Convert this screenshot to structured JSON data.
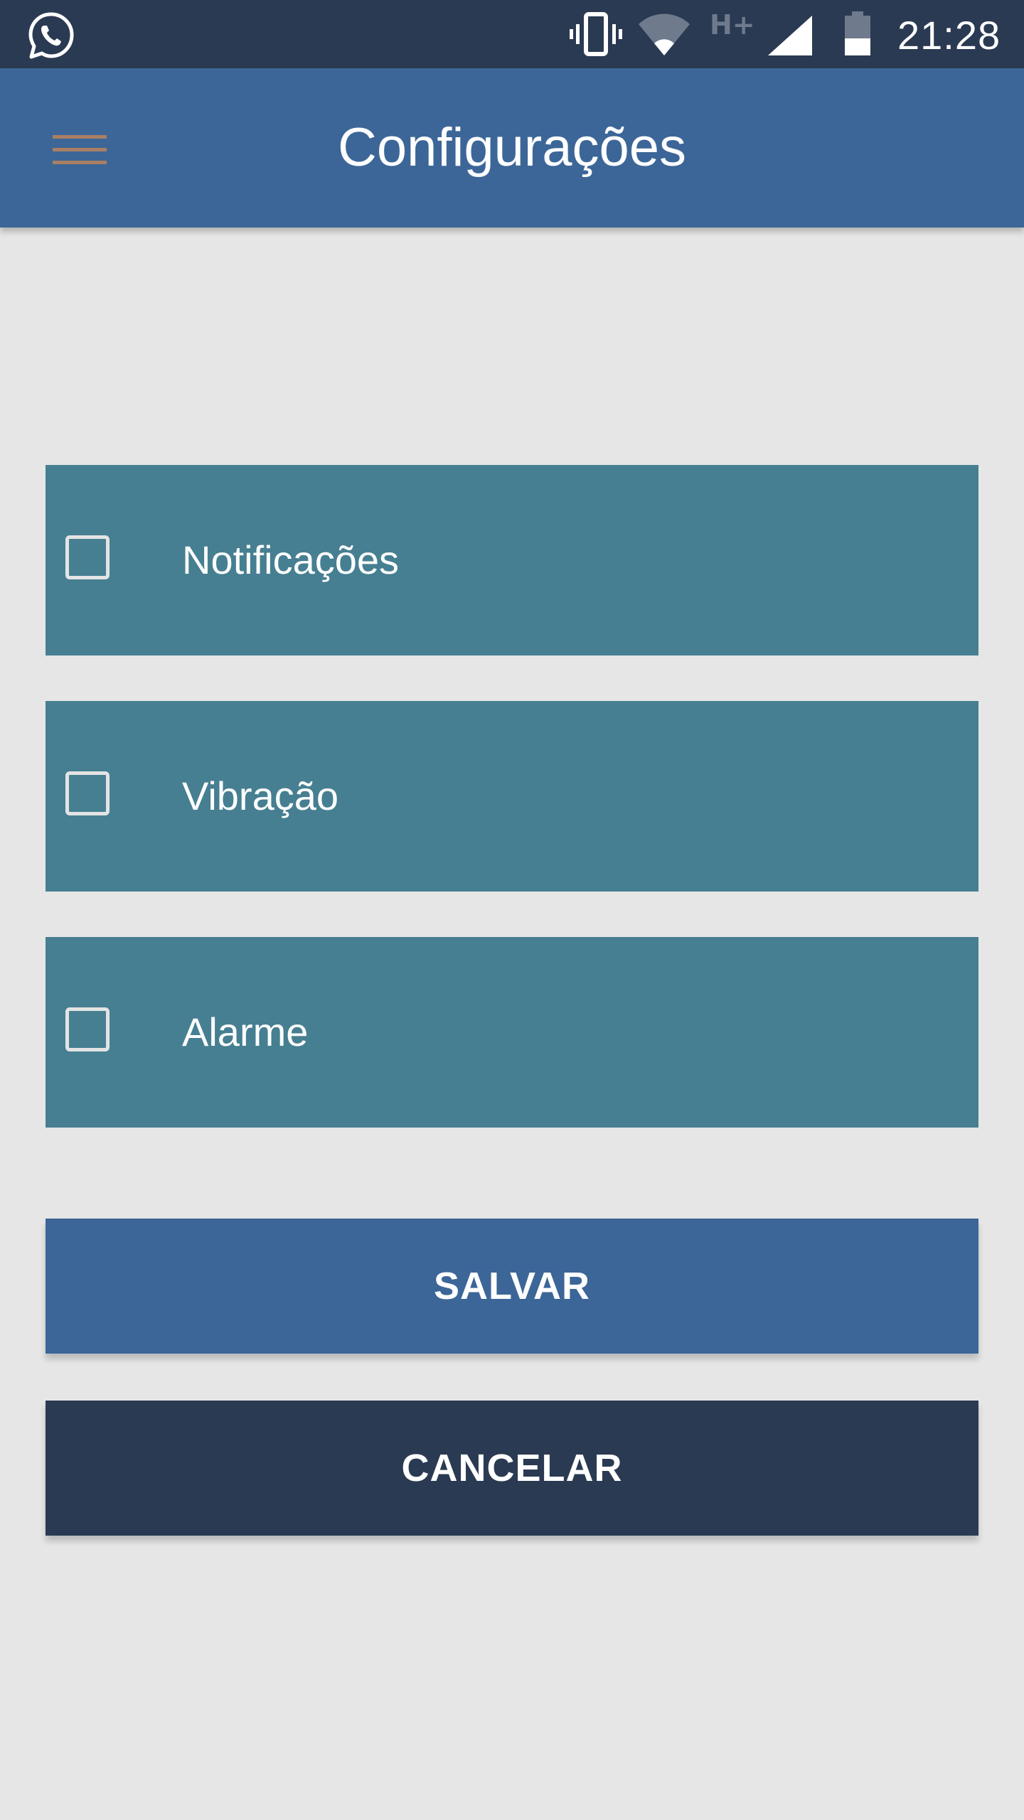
{
  "status_bar": {
    "time": "21:28",
    "network_type": "H+",
    "icons": [
      "whatsapp-icon",
      "vibrate-icon",
      "wifi-icon",
      "network-type-icon",
      "signal-icon",
      "battery-icon"
    ]
  },
  "app_bar": {
    "title": "Configurações",
    "menu_icon": "hamburger-menu-icon"
  },
  "options": [
    {
      "label": "Notificações",
      "checked": false
    },
    {
      "label": "Vibração",
      "checked": false
    },
    {
      "label": "Alarme",
      "checked": false
    }
  ],
  "actions": {
    "save_label": "SALVAR",
    "cancel_label": "CANCELAR"
  },
  "colors": {
    "status_bar": "#2a3a52",
    "app_bar": "#3c6698",
    "background": "#e6e6e6",
    "option_row": "#467f91",
    "save_button": "#3c6698",
    "cancel_button": "#2a3a52"
  }
}
